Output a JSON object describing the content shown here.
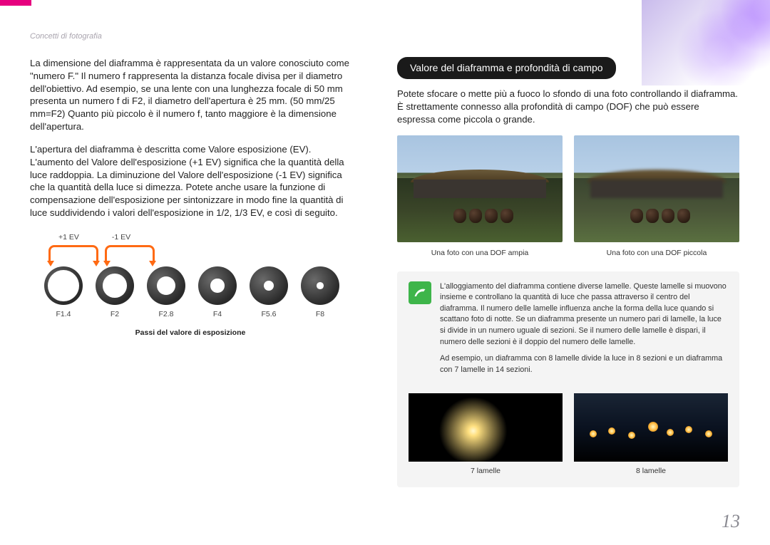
{
  "breadcrumb": "Concetti di fotografia",
  "left": {
    "p1": "La dimensione del diaframma è rappresentata da un valore conosciuto come \"numero F.\" Il numero f rappresenta la distanza focale divisa per il diametro dell'obiettivo. Ad esempio, se una lente con una lunghezza focale di 50 mm presenta un numero f di F2, il diametro dell'apertura è 25 mm. (50 mm/25 mm=F2) Quanto più piccolo è il numero f, tanto maggiore è la dimensione dell'apertura.",
    "p2": "L'apertura del diaframma è descritta come Valore esposizione (EV). L'aumento del Valore dell'esposizione (+1 EV) significa che la quantità della luce raddoppia. La diminuzione del Valore dell'esposizione (-1 EV) significa che la quantità della luce si dimezza. Potete anche usare la funzione di compensazione dell'esposizione per sintonizzare in modo fine la quantità di luce suddividendo i valori dell'esposizione in 1/2, 1/3 EV, e così di seguito.",
    "ev_plus": "+1 EV",
    "ev_minus": "-1 EV",
    "apertures": [
      "F1.4",
      "F2",
      "F2.8",
      "F4",
      "F5.6",
      "F8"
    ],
    "ev_caption": "Passi del valore di esposizione"
  },
  "right": {
    "section_title": "Valore del diaframma e profondità di campo",
    "p1": "Potete sfocare o mette più a fuoco lo sfondo di una foto controllando il diaframma. È strettamente connesso alla profondità di campo (DOF) che può essere espressa come piccola o grande.",
    "caption_wide": "Una foto con una DOF ampia",
    "caption_narrow": "Una foto con una DOF piccola",
    "note_p1": "L'alloggiamento del diaframma contiene diverse lamelle. Queste lamelle si muovono insieme e controllano la quantità di luce che passa attraverso il centro del diaframma. Il numero delle lamelle influenza anche la forma della luce quando si scattano foto di notte. Se un diaframma presente un numero pari di lamelle, la luce si divide in un numero uguale di sezioni. Se il numero delle lamelle è dispari, il numero delle sezioni è il doppio del numero delle lamelle.",
    "note_p2": "Ad esempio, un diaframma con 8 lamelle divide la luce in 8 sezioni e un diaframma con 7 lamelle in 14 sezioni.",
    "caption_7": "7 lamelle",
    "caption_8": "8 lamelle"
  },
  "chart_data": {
    "type": "table",
    "title": "Passi del valore di esposizione",
    "fstops": [
      "F1.4",
      "F2",
      "F2.8",
      "F4",
      "F5.6",
      "F8"
    ],
    "relative_aperture_diameter_pct": [
      82,
      62,
      48,
      36,
      26,
      18
    ],
    "ev_step_labels": [
      "+1 EV",
      "-1 EV"
    ]
  },
  "page_number": "13"
}
